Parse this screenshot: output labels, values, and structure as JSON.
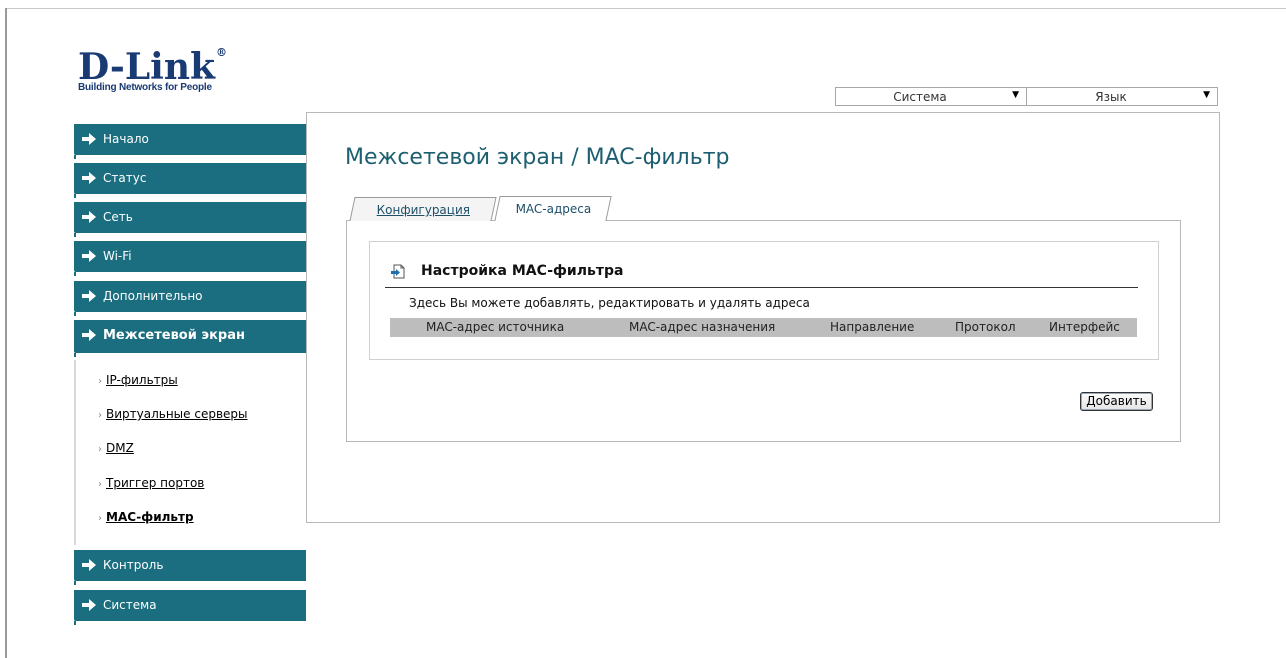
{
  "logo": {
    "brand": "D-Link",
    "reg": "®",
    "tagline": "Building Networks for People"
  },
  "top_menu": {
    "system": {
      "label": "Система"
    },
    "language": {
      "label": "Язык"
    }
  },
  "sidebar": {
    "items": [
      {
        "label": "Начало"
      },
      {
        "label": "Статус"
      },
      {
        "label": "Сеть"
      },
      {
        "label": "Wi-Fi"
      },
      {
        "label": "Дополнительно"
      },
      {
        "label": "Межсетевой экран"
      },
      {
        "label": "Контроль"
      },
      {
        "label": "Система"
      }
    ],
    "submenu": [
      {
        "label": "IP-фильтры"
      },
      {
        "label": "Виртуальные серверы"
      },
      {
        "label": "DMZ"
      },
      {
        "label": "Триггер портов"
      },
      {
        "label": "MAC-фильтр"
      }
    ]
  },
  "main": {
    "title": "Межсетевой экран / MAC-фильтр",
    "tabs": [
      {
        "label": "Конфигурация"
      },
      {
        "label": "MAC-адреса"
      }
    ],
    "section": {
      "title": "Настройка MAC-фильтра",
      "description": "Здесь Вы можете добавлять, редактировать и удалять адреса"
    },
    "table": {
      "columns": [
        "MAC-адрес источника",
        "MAC-адрес назначения",
        "Направление",
        "Протокол",
        "Интерфейс"
      ]
    },
    "add_button": "Добавить"
  },
  "colors": {
    "sidebar_bg": "#1a6e80",
    "title_color": "#1d5f70",
    "table_header_bg": "#bdbdbd",
    "logo_color": "#1a3a74"
  }
}
